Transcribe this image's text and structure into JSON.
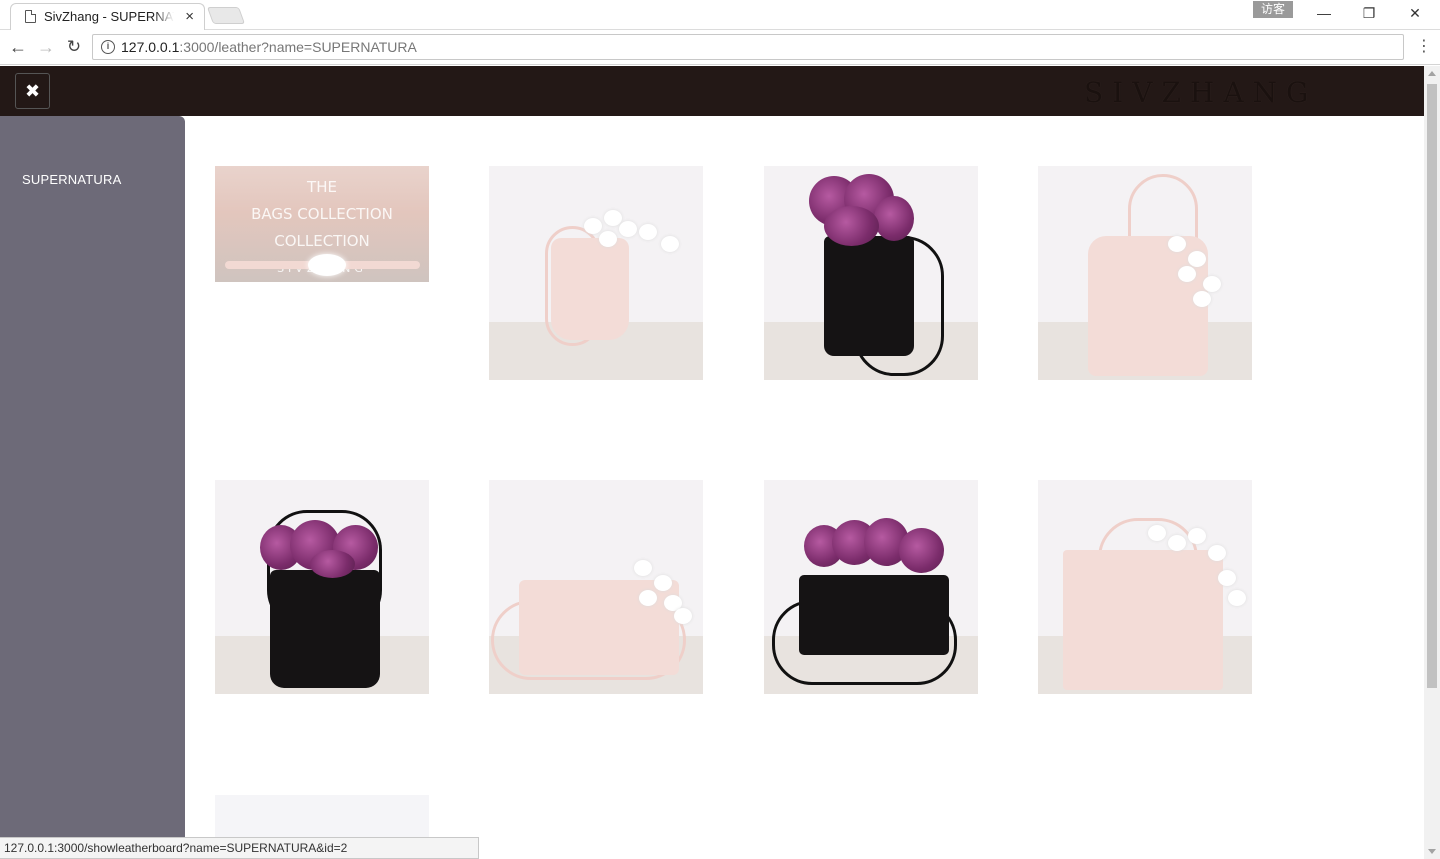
{
  "browser": {
    "tab_title": "SivZhang - SUPERNATURA",
    "tab_close": "×",
    "guest_label": "访客",
    "url_host": "127.0.0.1",
    "url_rest": ":3000/leather?name=SUPERNATURA",
    "status_url": "127.0.0.1:3000/showleatherboard?name=SUPERNATURA&id=2",
    "window_controls": [
      "—",
      "❐",
      "✕"
    ]
  },
  "site": {
    "logo": "SIVZHANG",
    "close_icon": "✖",
    "sidebar_items": [
      {
        "label": "SUPERNATURA"
      }
    ]
  },
  "cover": {
    "lines": [
      "THE",
      "BAGS COLLECTION",
      "COLLECTION",
      "SIVZHANG"
    ]
  },
  "products": [
    {
      "name": "cover",
      "color": "pink"
    },
    {
      "name": "pink-bucket-bag",
      "color": "pink"
    },
    {
      "name": "black-bucket-bag-flowers",
      "color": "black"
    },
    {
      "name": "pink-tote-orchid",
      "color": "pink"
    },
    {
      "name": "black-bucket-backpack-flowers",
      "color": "black"
    },
    {
      "name": "pink-clutch-orchid",
      "color": "pink"
    },
    {
      "name": "black-clutch-flowers",
      "color": "black"
    },
    {
      "name": "pink-square-tote-orchid",
      "color": "pink"
    },
    {
      "name": "partial-item",
      "color": "light"
    }
  ]
}
